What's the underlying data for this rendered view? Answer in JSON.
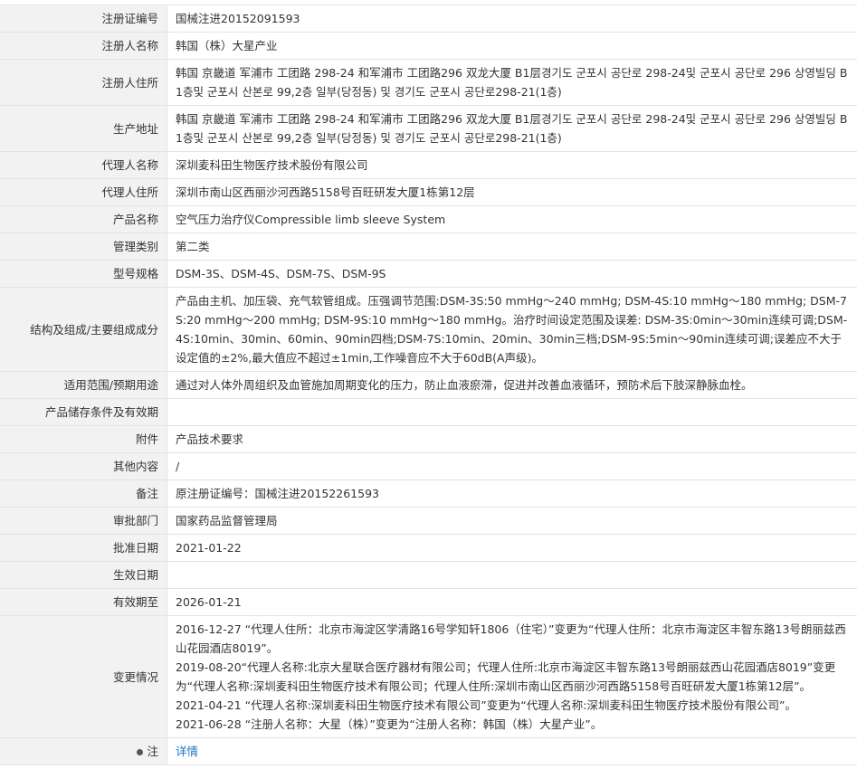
{
  "rows": [
    {
      "key": "reg_no",
      "label": "注册证编号",
      "value": "国械注进20152091593"
    },
    {
      "key": "registrant_name",
      "label": "注册人名称",
      "value": "韩国（株）大星产业"
    },
    {
      "key": "registrant_address",
      "label": "注册人住所",
      "value": "韩国 京畿道 军浦市 工团路 298-24 和军浦市 工团路296 双龙大厦 B1层경기도 군포시 공단로 298-24및 군포시 공단로 296 상영빌딩 B1층및 군포시 산본로 99,2층 일부(당정동) 및 경기도 군포시 공단로298-21(1층)"
    },
    {
      "key": "production_address",
      "label": "生产地址",
      "value": "韩国 京畿道 军浦市 工团路 298-24 和军浦市 工团路296 双龙大厦 B1层경기도 군포시 공단로 298-24및 군포시 공단로 296 상영빌딩 B1층및 군포시 산본로 99,2층 일부(당정동) 및 경기도 군포시 공단로298-21(1층)"
    },
    {
      "key": "agent_name",
      "label": "代理人名称",
      "value": "深圳麦科田生物医疗技术股份有限公司"
    },
    {
      "key": "agent_address",
      "label": "代理人住所",
      "value": "深圳市南山区西丽沙河西路5158号百旺研发大厦1栋第12层"
    },
    {
      "key": "product_name",
      "label": "产品名称",
      "value": "空气压力治疗仪Compressible limb sleeve System"
    },
    {
      "key": "management_class",
      "label": "管理类别",
      "value": "第二类"
    },
    {
      "key": "model",
      "label": "型号规格",
      "value": "DSM-3S、DSM-4S、DSM-7S、DSM-9S"
    },
    {
      "key": "composition",
      "label": "结构及组成/主要组成成分",
      "value": "产品由主机、加压袋、充气软管组成。压强调节范围:DSM-3S:50 mmHg～240 mmHg; DSM-4S:10 mmHg～180 mmHg; DSM-7S:20 mmHg～200 mmHg; DSM-9S:10 mmHg～180 mmHg。治疗时间设定范围及误差: DSM-3S:0min～30min连续可调;DSM-4S:10min、30min、60min、90min四档;DSM-7S:10min、20min、30min三档;DSM-9S:5min～90min连续可调;误差应不大于设定值的±2%,最大值应不超过±1min,工作噪音应不大于60dB(A声级)。"
    },
    {
      "key": "intended_use",
      "label": "适用范围/预期用途",
      "value": "通过对人体外周组织及血管施加周期变化的压力，防止血液瘀滞，促进并改善血液循环，预防术后下肢深静脉血栓。"
    },
    {
      "key": "storage",
      "label": "产品储存条件及有效期",
      "value": ""
    },
    {
      "key": "attachment",
      "label": "附件",
      "value": "产品技术要求"
    },
    {
      "key": "other",
      "label": "其他内容",
      "value": "/"
    },
    {
      "key": "remark",
      "label": "备注",
      "value": "原注册证编号：国械注进20152261593"
    },
    {
      "key": "approval_dept",
      "label": "审批部门",
      "value": "国家药品监督管理局"
    },
    {
      "key": "approval_date",
      "label": "批准日期",
      "value": "2021-01-22"
    },
    {
      "key": "effective_date",
      "label": "生效日期",
      "value": ""
    },
    {
      "key": "valid_until",
      "label": "有效期至",
      "value": "2026-01-21"
    }
  ],
  "changes": {
    "label": "变更情况",
    "items": [
      "2016-12-27 “代理人住所：北京市海淀区学清路16号学知轩1806（住宅）”变更为“代理人住所：北京市海淀区丰智东路13号朗丽兹西山花园酒店8019”。",
      "2019-08-20“代理人名称:北京大星联合医疗器材有限公司；代理人住所:北京市海淀区丰智东路13号朗丽兹西山花园酒店8019”变更为“代理人名称:深圳麦科田生物医疗技术有限公司；代理人住所:深圳市南山区西丽沙河西路5158号百旺研发大厦1栋第12层”。",
      "2021-04-21 “代理人名称:深圳麦科田生物医疗技术有限公司”变更为“代理人名称:深圳麦科田生物医疗技术股份有限公司”。",
      "2021-06-28 “注册人名称：大星（株）”变更为“注册人名称：韩国（株）大星产业”。"
    ]
  },
  "note": {
    "label": "注",
    "link_text": "详情"
  }
}
